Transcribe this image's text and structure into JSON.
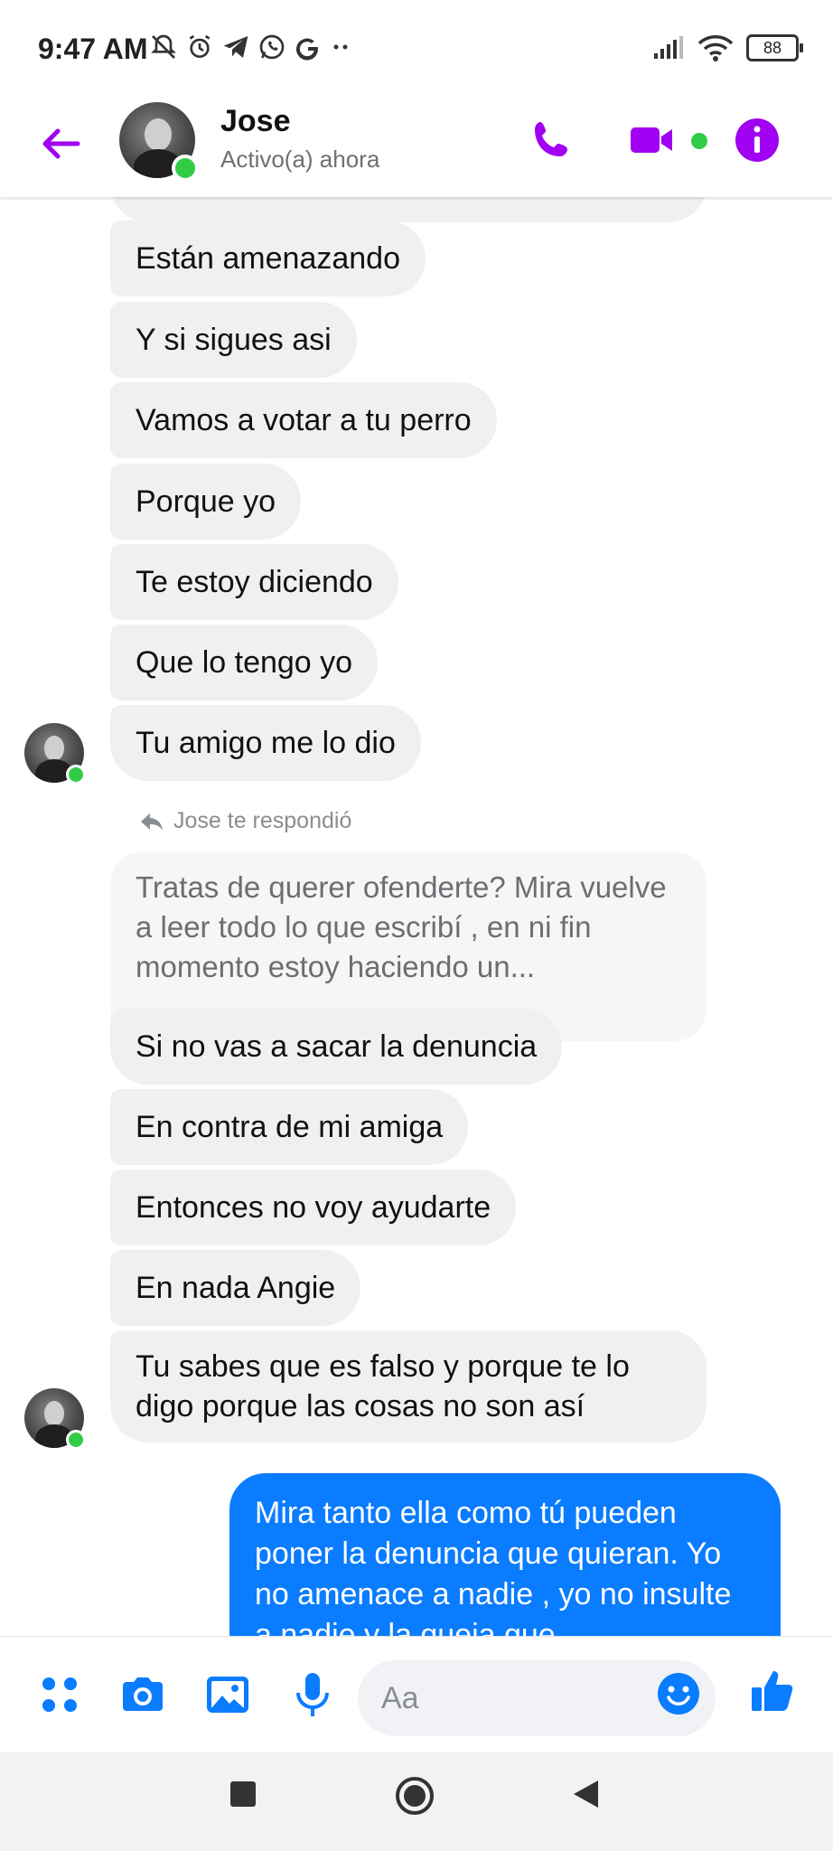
{
  "status_bar": {
    "time": "9:47 AM",
    "battery": "88",
    "icons": [
      "muted-bell-icon",
      "alarm-icon",
      "telegram-icon",
      "whatsapp-icon",
      "google-icon",
      "more-dots-icon",
      "signal-icon",
      "wifi-icon",
      "battery-icon"
    ]
  },
  "header": {
    "contact_name": "Jose",
    "contact_status": "Activo(a) ahora",
    "accent_color": "#a100f2"
  },
  "messages_received_1": [
    "Están amenazando",
    "Y si sigues asi",
    "Vamos a votar a tu perro",
    "Porque yo",
    "Te estoy diciendo",
    "Que lo tengo yo",
    "Tu amigo me lo dio"
  ],
  "reply": {
    "label": "Jose te respondió",
    "quoted_text": "Tratas de querer ofenderte? Mira vuelve a leer todo lo que escribí , en ni fin momento estoy haciendo un..."
  },
  "messages_received_2": [
    "Si no vas a sacar la denuncia",
    "En contra de mi amiga",
    "Entonces no voy ayudarte",
    "En nada Angie",
    "Tu sabes que es falso y porque te lo digo porque las cosas no son así"
  ],
  "message_sent": "Mira tanto ella como tú pueden poner la denuncia que quieran. Yo no amenace a nadie , yo no insulte a nadie y la queja que",
  "composer": {
    "placeholder": "Aa",
    "accent_color": "#0a7cff"
  }
}
